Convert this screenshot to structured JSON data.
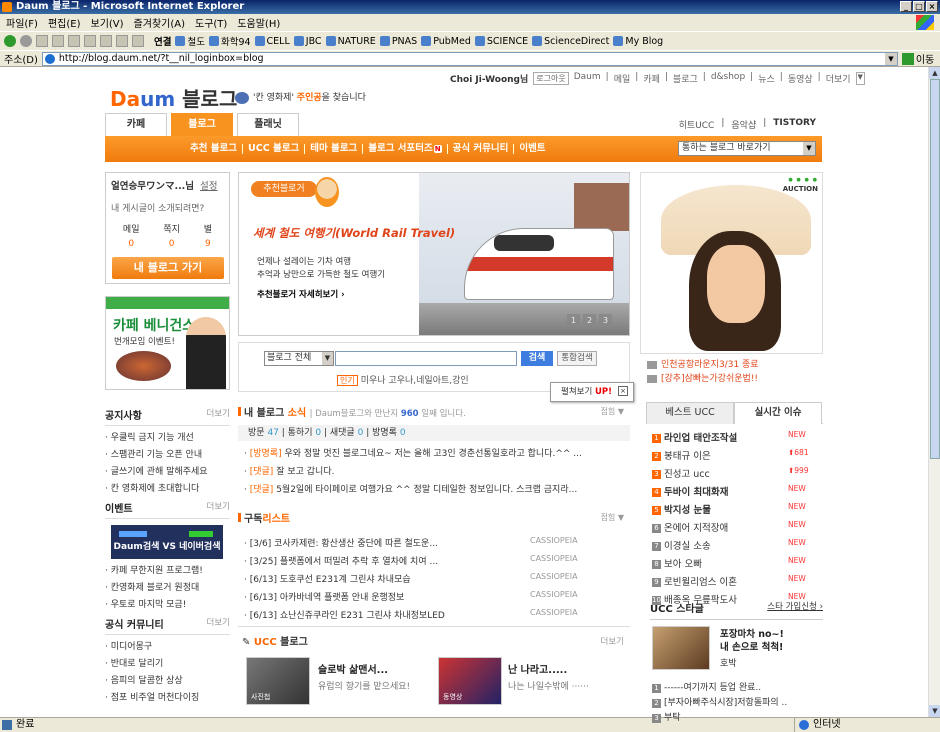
{
  "window": {
    "title": "Daum 블로그 - Microsoft Internet Explorer"
  },
  "menu": [
    "파일(F)",
    "편집(E)",
    "보기(V)",
    "즐겨찾기(A)",
    "도구(T)",
    "도움말(H)"
  ],
  "links_bar": {
    "label": "연결",
    "items": [
      "철도",
      "화학94",
      "CELL",
      "JBC",
      "NATURE",
      "PNAS",
      "PubMed",
      "SCIENCE",
      "ScienceDirect",
      "My Blog"
    ]
  },
  "address": {
    "label": "주소(D)",
    "url": "http://blog.daum.net/?t__nil_loginbox=blog",
    "go": "이동"
  },
  "status": {
    "text": "완료",
    "zone": "인터넷"
  },
  "top_links": {
    "user": "Choi Ji-Woong님",
    "logout": "로그아웃",
    "items": [
      "Daum",
      "메일",
      "카페",
      "블로그",
      "d&shop",
      "뉴스",
      "동영상",
      "더보기"
    ]
  },
  "logo": {
    "d": "Da",
    "m": "um",
    "blog": "블로그"
  },
  "tagline": {
    "pre": "'칸 영화제' ",
    "hl": "주인공",
    "post": "을 찾습니다"
  },
  "tabs": [
    "카페",
    "블로그",
    "플래닛"
  ],
  "right_links": [
    "히트UCC",
    "음악샵",
    "TISTORY"
  ],
  "orange_menu": [
    "추천 블로그",
    "UCC 블로그",
    "테마 블로그",
    "블로그 서포터즈",
    "공식 커뮤니티",
    "이벤트"
  ],
  "orange_badge": "N",
  "quick_select": "통하는 블로그 바로가기",
  "login_box": {
    "name": "얼연승무ワンマ...님",
    "settings": "설정",
    "question": "내 게시글이 소개되려면?",
    "counts": [
      {
        "label": "메일",
        "value": "0"
      },
      {
        "label": "쪽지",
        "value": "0"
      },
      {
        "label": "별",
        "value": "9"
      }
    ],
    "button": "내 블로그 가기"
  },
  "cafe_banner": {
    "title": "카페 베니건스",
    "sub": "번개모임 이벤트!"
  },
  "hero": {
    "badge": "추천블로거",
    "title": "세계 철도 여행기(World Rail Travel)",
    "desc1": "언제나 설레이는 기차 여행",
    "desc2": "추억과 낭만으로 가득한 철도 여행기",
    "more": "추천블로거 자세히보기",
    "pages": [
      "1",
      "2",
      "3"
    ]
  },
  "search": {
    "scope": "블로그 전체",
    "button": "검색",
    "integrated": "통합검색",
    "hot_label": "인기",
    "hot": "미우나 고우나,네일아트,강인"
  },
  "tooltip": {
    "label": "펼쳐보기",
    "up": "UP!"
  },
  "notice": {
    "title": "공지사항",
    "more": "더보기",
    "items": [
      "우클릭 금지 기능 개선",
      "스팸관리 기능 오픈 안내",
      "글쓰기에 관해 말해주세요",
      "칸 영화제에 초대합니다"
    ]
  },
  "event": {
    "title": "이벤트",
    "more": "더보기",
    "banner": "Daum검색 VS 네이버검색",
    "items": [
      "카페 무한지원 프로그램!",
      "칸영화제 블로거 원정대",
      "우토로 마지막 모금!"
    ]
  },
  "community": {
    "title": "공식 커뮤니티",
    "more": "더보기",
    "items": [
      "미디어몽구",
      "반대로 달리기",
      "음피의 달콤한 상상",
      "점포 비주얼 머천다이징"
    ]
  },
  "news": {
    "title_pre": "내 블로그 ",
    "title_hl": "소식",
    "sub_pre": "Daum블로그와 만난지 ",
    "sub_days": "960",
    "sub_post": "일째 입니다.",
    "fold": "접힘",
    "stats": [
      {
        "label": "방문",
        "value": "47"
      },
      {
        "label": "통하기",
        "value": "0"
      },
      {
        "label": "새댓글",
        "value": "0"
      },
      {
        "label": "방명록",
        "value": "0"
      }
    ],
    "items": [
      {
        "tag": "[방명록]",
        "text": "우와 정말 멋진 블로그네요~ 저는 올해 고3인 경춘선통일호라고 합니다.^^ ..."
      },
      {
        "tag": "[댓글]",
        "text": "잘 보고 갑니다."
      },
      {
        "tag": "[댓글]",
        "text": "5월2일에 타이페이로 여행가요 ^^ 정말 디테일한 정보입니다. 스크랩 금지라..."
      }
    ]
  },
  "subscribe": {
    "title_pre": "구독",
    "title_hl": "리스트",
    "fold": "접힘",
    "items": [
      {
        "text": "[3/6] 코사카제련: 황산생산 중단에 따른 철도운...",
        "src": "CASSIOPEIA"
      },
      {
        "text": "[3/25] 플랫폼에서 떠밀려 추락 후 열차에 치여 ...",
        "src": "CASSIOPEIA"
      },
      {
        "text": "[6/13] 도호쿠선 E231계 그린샤 차내모습",
        "src": "CASSIOPEIA"
      },
      {
        "text": "[6/13] 아카바네역 플랫폼 안내 운행정보",
        "src": "CASSIOPEIA"
      },
      {
        "text": "[6/13] 쇼난신쥬쿠라인 E231 그린샤 차내정보LED",
        "src": "CASSIOPEIA"
      }
    ]
  },
  "ucc": {
    "title_hl": "UCC",
    "title": " 블로그",
    "more": "더보기",
    "a_title": "슬로박 삶맨서...",
    "a_desc": "유럽의 향기를 맡으세요!",
    "a_caption": "사진첩",
    "b_title": "난 나라고.....",
    "b_desc": "나는 나일수밖에 ······",
    "b_caption": "동영상"
  },
  "ad": {
    "brand": "AUCTION",
    "links": [
      "인천공항라운지3/31 종료",
      "[강추]삼빠는가강쉬운법!!"
    ]
  },
  "right_tabs": [
    "베스트 UCC",
    "실시간 이슈"
  ],
  "issues": [
    {
      "rank": "1",
      "title": "라인업 태안조작설",
      "status": "NEW",
      "bold": true
    },
    {
      "rank": "2",
      "title": "봉태규 이은",
      "status": "681",
      "bold": false
    },
    {
      "rank": "3",
      "title": "진성고 ucc",
      "status": "999",
      "bold": false
    },
    {
      "rank": "4",
      "title": "두바이 최대화재",
      "status": "NEW",
      "bold": true
    },
    {
      "rank": "5",
      "title": "박지성 눈물",
      "status": "NEW",
      "bold": true
    },
    {
      "rank": "6",
      "title": "온에어 지적장애",
      "status": "NEW",
      "bold": false
    },
    {
      "rank": "7",
      "title": "이경실 소송",
      "status": "NEW",
      "bold": false
    },
    {
      "rank": "8",
      "title": "보아 오빠",
      "status": "NEW",
      "bold": false
    },
    {
      "rank": "9",
      "title": "로빈윌리엄스 이혼",
      "status": "NEW",
      "bold": false
    },
    {
      "rank": "10",
      "title": "배종옥 무릎팍도사",
      "status": "NEW",
      "bold": false
    }
  ],
  "ucc_star": {
    "title": "UCC 스타글",
    "join": "스타 가입신청",
    "post_title1": "포장마차 no~!",
    "post_title2": "내 손으로 척척!",
    "post_author": "호박",
    "items": [
      "------여기까지 등업 완료..",
      "[부자아빠주식시장]저항돌파의 ..",
      "부탁"
    ]
  }
}
